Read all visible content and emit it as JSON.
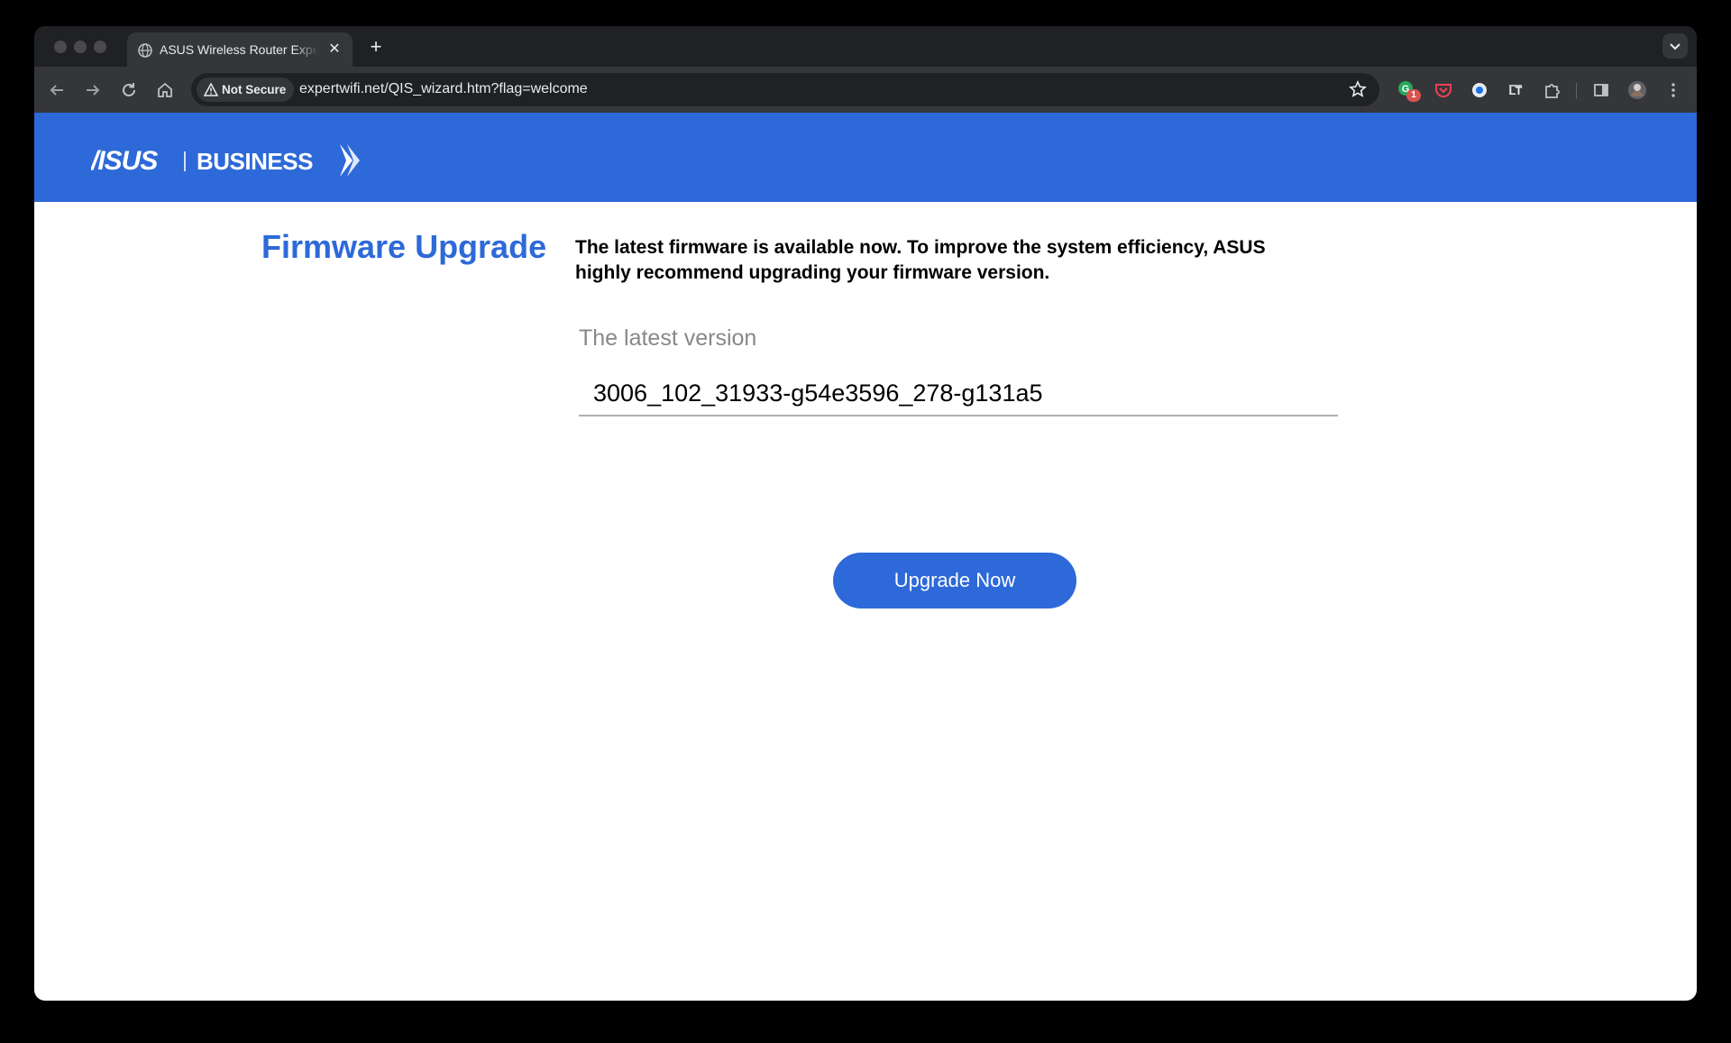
{
  "browser": {
    "tab_title": "ASUS Wireless Router Expert",
    "new_tab_symbol": "+",
    "close_symbol": "✕",
    "security_chip": "Not Secure",
    "url": "expertwifi.net/QIS_wizard.htm?flag=welcome",
    "extension_badge": "1"
  },
  "brand": {
    "logo_text": "ASUS | BUSINESS",
    "banner_color": "#2d69d8"
  },
  "main": {
    "title": "Firmware Upgrade",
    "description": "The latest firmware is available now. To improve the system efficiency, ASUS highly recommend upgrading your firmware version.",
    "version_label": "The latest version",
    "version_value": "3006_102_31933-g54e3596_278-g131a5",
    "upgrade_button": "Upgrade Now"
  }
}
